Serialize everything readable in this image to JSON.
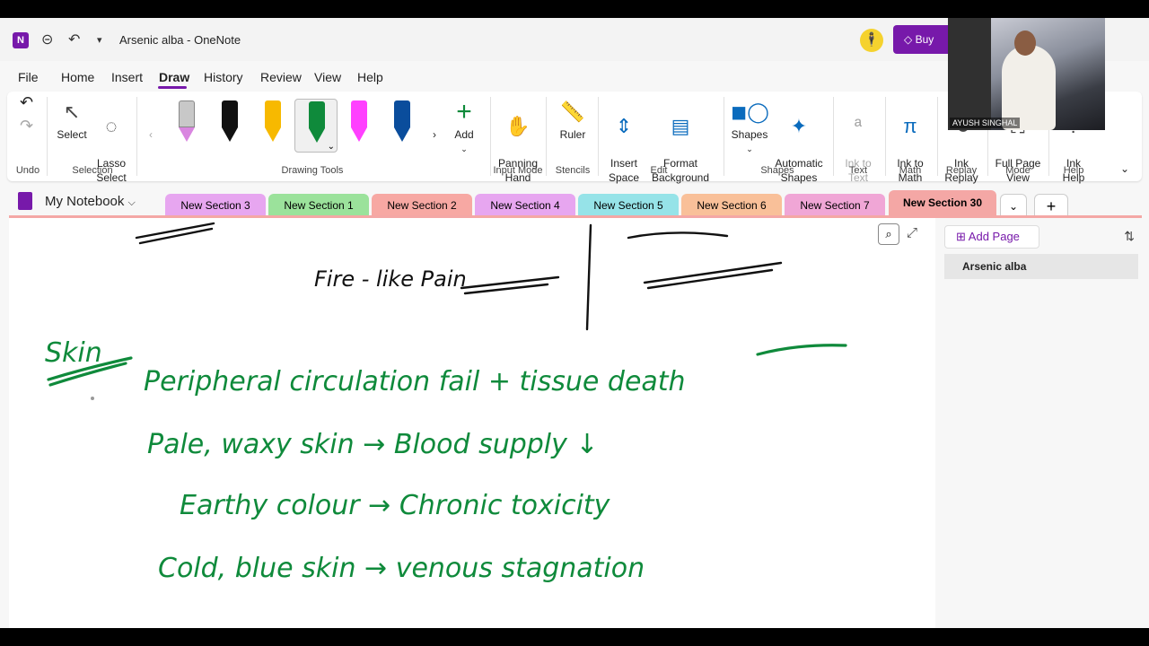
{
  "window": {
    "doc_title": "Arsenic alba  -  OneNote",
    "buy_label": "Buy"
  },
  "menu": {
    "tabs": [
      "File",
      "Home",
      "Insert",
      "Draw",
      "History",
      "Review",
      "View",
      "Help"
    ],
    "active": "Draw"
  },
  "ribbon": {
    "undo_group": "Undo",
    "select_label": "Select",
    "lasso_label": "Lasso\nSelect",
    "selection_group": "Selection",
    "drawing_tools_group": "Drawing Tools",
    "pens": [
      {
        "name": "eraser",
        "color": "#c8c8c8"
      },
      {
        "name": "black-pen",
        "color": "#111111"
      },
      {
        "name": "yellow-pen",
        "color": "#f7b900"
      },
      {
        "name": "green-pen",
        "color": "#0f8a3b"
      },
      {
        "name": "magenta-highlighter",
        "color": "#ff40ff"
      },
      {
        "name": "blue-pen",
        "color": "#0a4d9c"
      }
    ],
    "add_label": "Add",
    "panning_label": "Panning\nHand",
    "input_mode_group": "Input Mode",
    "ruler_label": "Ruler",
    "stencils_group": "Stencils",
    "insert_space_label": "Insert\nSpace",
    "format_bg_label": "Format\nBackground",
    "edit_group": "Edit",
    "shapes_label": "Shapes",
    "auto_shapes_label": "Automatic\nShapes",
    "shapes_group": "Shapes",
    "ink_text_label": "Ink to\nText",
    "text_group": "Text",
    "ink_math_label": "Ink to\nMath",
    "math_group": "Math",
    "ink_replay_label": "Ink\nReplay",
    "replay_group": "Replay",
    "full_page_label": "Full Page\nView",
    "mode_group": "Mode",
    "ink_help_label": "Ink\nHelp",
    "help_group": "Help"
  },
  "notebook": {
    "name": "My Notebook"
  },
  "sections": [
    {
      "label": "New Section 3",
      "color": "#e7a6f0"
    },
    {
      "label": "New Section 1",
      "color": "#9be29b"
    },
    {
      "label": "New Section 2",
      "color": "#f7a8a3"
    },
    {
      "label": "New Section 4",
      "color": "#e7a6f0"
    },
    {
      "label": "New Section 5",
      "color": "#96e3e8"
    },
    {
      "label": "New Section 6",
      "color": "#f9c099"
    },
    {
      "label": "New Section 7",
      "color": "#f0a6d6"
    },
    {
      "label": "New Section 30",
      "color": "#f4a7a5"
    }
  ],
  "pages": {
    "add_label": "Add Page",
    "items": [
      "Arsenic alba"
    ]
  },
  "ink": {
    "line_top_left": "Fire - like Pain",
    "heading": "Skin",
    "line1": "Peripheral circulation fail + tissue death",
    "line2": "Pale, waxy skin → Blood supply ↓",
    "line3": "Earthy colour  →  Chronic toxicity",
    "line4": "Cold, blue skin  →  venous stagnation"
  },
  "webcam": {
    "name": "AYUSH SINGHAL"
  }
}
